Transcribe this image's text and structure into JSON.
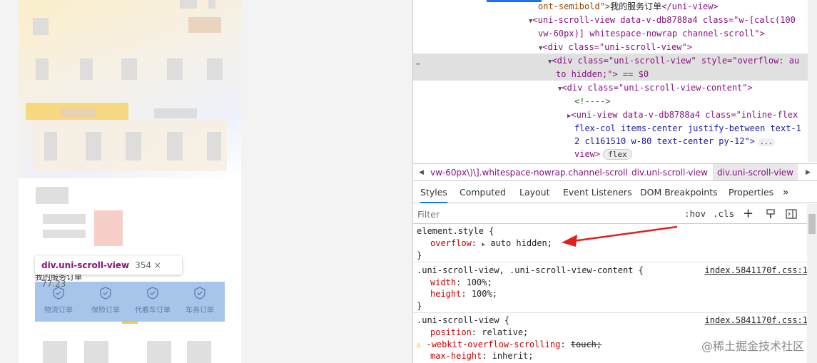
{
  "preview": {
    "tooltip": {
      "element": "div.uni-scroll-view",
      "size": "354 × 77.23"
    },
    "section_title": "我的服务订单",
    "services": [
      {
        "label": "物流订单",
        "icon": "shield-icon"
      },
      {
        "label": "保险订单",
        "icon": "shield-icon"
      },
      {
        "label": "代看车订单",
        "icon": "shield-icon"
      },
      {
        "label": "车务订单",
        "icon": "shield-icon"
      }
    ]
  },
  "elements": {
    "lines": [
      [
        "ont-semibold\">",
        "我的服务订单",
        "</uni-view>"
      ],
      [
        "<uni-scroll-view data-v-db8788a4 class=\"w-[calc(100"
      ],
      [
        "vw-60px)] whitespace-nowrap channel-scroll\">"
      ],
      [
        "<div class=\"uni-scroll-view\">"
      ],
      [
        "<div class=\"uni-scroll-view\" style=\"overflow: au"
      ],
      [
        "to hidden;\"> == $0"
      ],
      [
        "<div class=\"uni-scroll-view-content\">"
      ],
      [
        "<!---->"
      ],
      [
        "<uni-view data-v-db8788a4 class=\"inline-flex"
      ],
      [
        "flex-col items-center justify-between text-1"
      ],
      [
        "2 cl161510 w-80 text-center py-12\">"
      ],
      [
        "view>"
      ]
    ],
    "flex_badge": "flex",
    "ellipsis": "...",
    "more_dots": "⋯"
  },
  "breadcrumbs": [
    "vw-60px\\)\\].whitespace-nowrap.channel-scroll",
    "div.uni-scroll-view",
    "div.uni-scroll-view"
  ],
  "tabs": [
    "Styles",
    "Computed",
    "Layout",
    "Event Listeners",
    "DOM Breakpoints",
    "Properties"
  ],
  "filter": {
    "placeholder": "Filter",
    "hov": ":hov",
    "cls": ".cls",
    "plus": "+"
  },
  "styles": {
    "rule1": {
      "selector": "element.style {",
      "prop": "overflow",
      "value": "auto hidden;",
      "close": "}"
    },
    "rule2": {
      "selector": ".uni-scroll-view, .uni-scroll-view-content {",
      "source": "index.5841170f.css:1",
      "props": [
        [
          "width",
          "100%;"
        ],
        [
          "height",
          "100%;"
        ]
      ],
      "close": "}"
    },
    "rule3": {
      "selector": ".uni-scroll-view {",
      "source": "index.5841170f.css:1",
      "props": [
        [
          "position",
          "relative;"
        ],
        [
          "-webkit-overflow-scrolling",
          "touch;"
        ],
        [
          "max-height",
          "inherit;"
        ]
      ]
    }
  },
  "watermark": "@稀土掘金技术社区",
  "colors": {
    "arrow": "#e0201b",
    "highlight": "#a7c5ea",
    "accent": "#1a73e8"
  }
}
